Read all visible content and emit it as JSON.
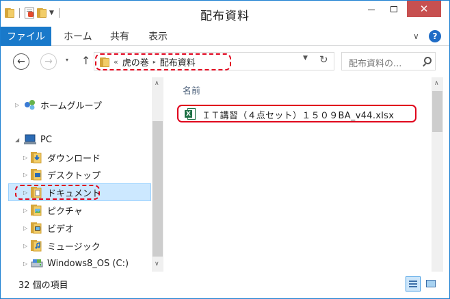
{
  "window": {
    "title": "配布資料",
    "close_glyph": "✕"
  },
  "ribbon": {
    "file": "ファイル",
    "home": "ホーム",
    "share": "共有",
    "view": "表示",
    "help": "?"
  },
  "nav": {
    "back": "←",
    "forward": "→",
    "up": "↑",
    "recent": "▾",
    "refresh": "↻",
    "address": {
      "overflow": "«",
      "crumbs": [
        "虎の巻",
        "配布資料"
      ],
      "separator": "▸"
    },
    "search_placeholder": "配布資料の..."
  },
  "tree": [
    {
      "label": "ホームグループ",
      "icon": "homegroup-icon",
      "expand": "▷"
    },
    {
      "label": "PC",
      "icon": "pc-icon",
      "expand": "◢"
    },
    {
      "label": "ダウンロード",
      "icon": "downloads-folder-icon",
      "expand": "▷"
    },
    {
      "label": "デスクトップ",
      "icon": "desktop-folder-icon",
      "expand": "▷"
    },
    {
      "label": "ドキュメント",
      "icon": "documents-folder-icon",
      "expand": "▷",
      "selected": true
    },
    {
      "label": "ピクチャ",
      "icon": "pictures-folder-icon",
      "expand": "▷"
    },
    {
      "label": "ビデオ",
      "icon": "videos-folder-icon",
      "expand": "▷"
    },
    {
      "label": "ミュージック",
      "icon": "music-folder-icon",
      "expand": "▷"
    },
    {
      "label": "Windows8_OS (C:)",
      "icon": "drive-icon",
      "expand": "▷"
    }
  ],
  "content": {
    "column_name": "名前",
    "files": [
      {
        "name": "ＩＴ講習（４点セット）１５０９BA_v44.xlsx",
        "icon": "excel-file-icon"
      }
    ]
  },
  "status": {
    "item_count": "32 個の項目"
  },
  "colors": {
    "accent": "#1979ca",
    "highlight": "#e0001b",
    "selection": "#cce8ff"
  }
}
